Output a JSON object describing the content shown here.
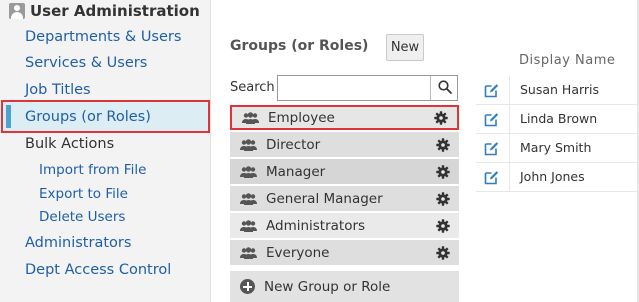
{
  "sidebar": {
    "title": "User Administration",
    "items": [
      {
        "label": "Departments & Users"
      },
      {
        "label": "Services & Users"
      },
      {
        "label": "Job Titles"
      },
      {
        "label": "Groups (or Roles)"
      },
      {
        "label": "Bulk Actions"
      },
      {
        "label": "Import from File"
      },
      {
        "label": "Export to File"
      },
      {
        "label": "Delete Users"
      },
      {
        "label": "Administrators"
      },
      {
        "label": "Dept Access Control"
      }
    ],
    "selected": "Groups (or Roles)"
  },
  "groups_panel": {
    "title": "Groups (or Roles)",
    "new_button": "New",
    "search_label": "Search",
    "search_value": "",
    "groups": [
      {
        "name": "Employee"
      },
      {
        "name": "Director"
      },
      {
        "name": "Manager"
      },
      {
        "name": "General Manager"
      },
      {
        "name": "Administrators"
      },
      {
        "name": "Everyone"
      }
    ],
    "new_group_label": "New Group or Role"
  },
  "users_table": {
    "column_header": "Display Name",
    "users": [
      {
        "name": "Susan Harris"
      },
      {
        "name": "Linda Brown"
      },
      {
        "name": "Mary Smith"
      },
      {
        "name": "John Jones"
      }
    ]
  },
  "icons": {
    "title_icon": "user-icon",
    "group_icon": "group-icon",
    "settings_icon": "gear-icon",
    "search_icon": "search-icon",
    "edit_icon": "edit-icon",
    "add_icon": "plus-circle-icon"
  },
  "colors": {
    "link": "#1f5fa8",
    "highlight_border": "#e0343b",
    "selected_bg": "#dcedf3",
    "selected_bar": "#4ba3cf",
    "edit_icon": "#2f7fc0"
  }
}
